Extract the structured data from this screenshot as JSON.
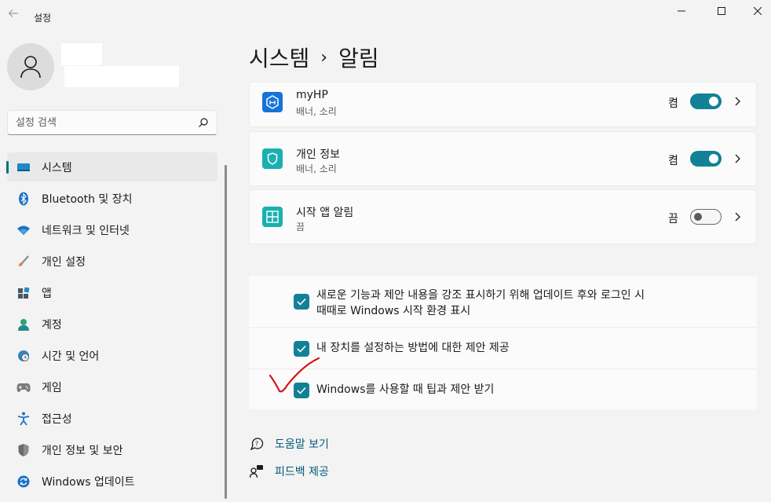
{
  "window": {
    "title": "설정",
    "back_icon": "arrow-left-icon",
    "controls": [
      "minimize-icon",
      "maximize-icon",
      "close-icon"
    ]
  },
  "profile": {
    "avatar_icon": "person-icon"
  },
  "search": {
    "placeholder": "설정 검색",
    "icon": "search-icon"
  },
  "sidebar": {
    "items": [
      {
        "label": "시스템",
        "icon": "monitor-icon",
        "active": true
      },
      {
        "label": "Bluetooth 및 장치",
        "icon": "bluetooth-icon"
      },
      {
        "label": "네트워크 및 인터넷",
        "icon": "wifi-icon"
      },
      {
        "label": "개인 설정",
        "icon": "brush-icon"
      },
      {
        "label": "앱",
        "icon": "apps-icon"
      },
      {
        "label": "계정",
        "icon": "account-icon"
      },
      {
        "label": "시간 및 언어",
        "icon": "globe-clock-icon"
      },
      {
        "label": "게임",
        "icon": "gamepad-icon"
      },
      {
        "label": "접근성",
        "icon": "accessibility-icon"
      },
      {
        "label": "개인 정보 및 보안",
        "icon": "shield-icon"
      },
      {
        "label": "Windows 업데이트",
        "icon": "sync-icon"
      }
    ]
  },
  "breadcrumb": {
    "parent": "시스템",
    "separator": "›",
    "current": "알림"
  },
  "apps": [
    {
      "name": "myHP",
      "sub": "배너, 소리",
      "state": "켬",
      "on": true,
      "icon": "myhp-icon"
    },
    {
      "name": "개인 정보",
      "sub": "배너, 소리",
      "state": "켬",
      "on": true,
      "icon": "privacy-shield-icon"
    },
    {
      "name": "시작 앱 알림",
      "sub": "끔",
      "state": "끔",
      "on": false,
      "icon": "startup-apps-icon"
    }
  ],
  "checks": [
    {
      "line1": "새로운 기능과 제안 내용을 강조 표시하기 위해 업데이트 후와 로그인 시",
      "line2": "때때로 Windows 시작 환경 표시",
      "checked": true
    },
    {
      "line1": "내 장치를 설정하는 방법에 대한 제안 제공",
      "checked": true
    },
    {
      "line1": "Windows를 사용할 때 팁과 제안 받기",
      "checked": true
    }
  ],
  "links": [
    {
      "label": "도움말 보기",
      "icon": "help-icon"
    },
    {
      "label": "피드백 제공",
      "icon": "feedback-icon"
    }
  ],
  "colors": {
    "accent": "#128196",
    "link": "#00587a",
    "annotation": "#d4141c"
  }
}
